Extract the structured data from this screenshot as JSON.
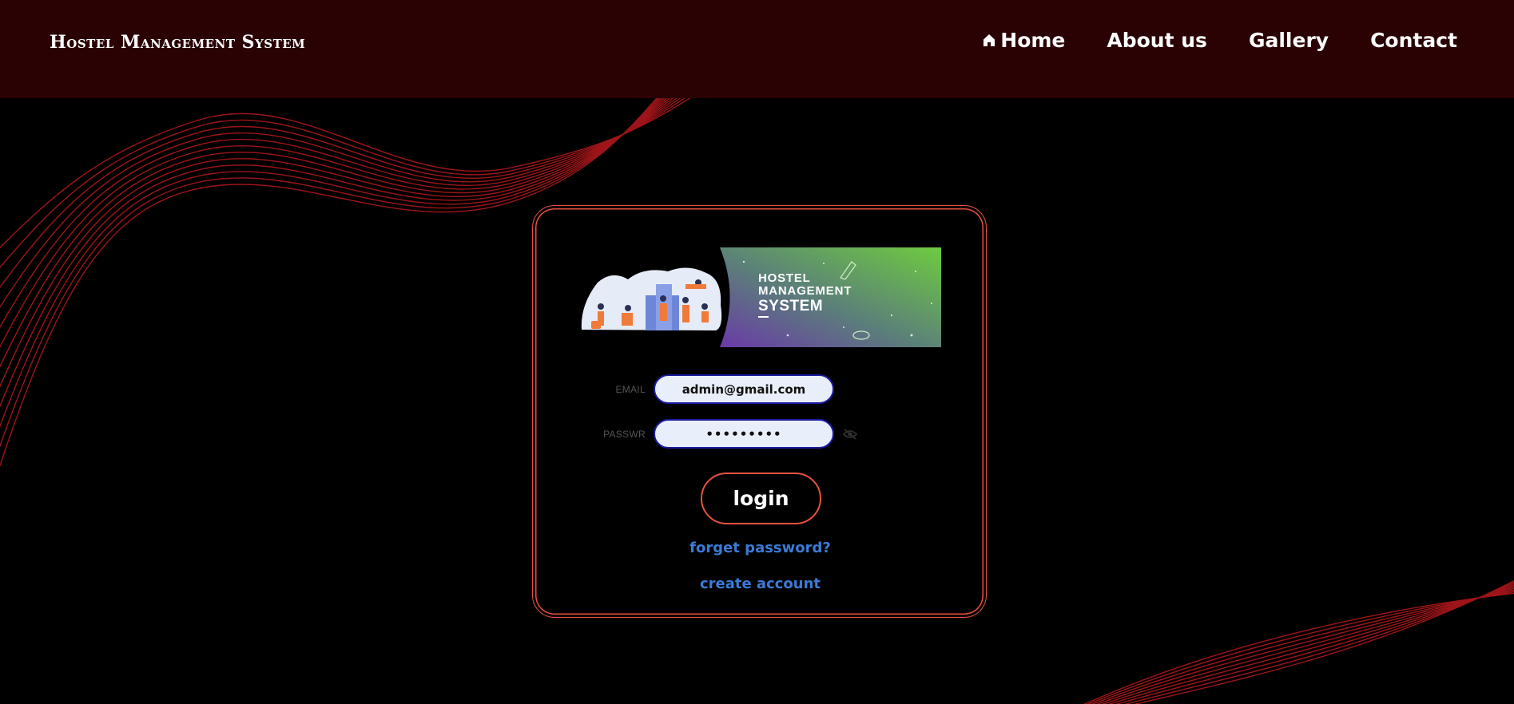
{
  "header": {
    "brand": "Hostel Management System",
    "nav": [
      {
        "label": "Home",
        "icon": "home-icon"
      },
      {
        "label": "About us"
      },
      {
        "label": "Gallery"
      },
      {
        "label": "Contact"
      }
    ]
  },
  "banner": {
    "line1": "HOSTEL",
    "line2": "MANAGEMENT",
    "line3": "SYSTEM"
  },
  "form": {
    "email_label": "EMAIL",
    "email_value": "admin@gmail.com",
    "password_label": "PASSWR",
    "password_value": "•••••••••",
    "password_toggle_icon": "eye-slash-icon",
    "login_label": "login",
    "forgot_label": "forget password?",
    "create_label": "create account"
  },
  "colors": {
    "header_bg": "#2b0203",
    "accent": "#e8523f",
    "link": "#3b7ad6",
    "input_border": "#1a1aa0",
    "wave": "#b0181c"
  }
}
